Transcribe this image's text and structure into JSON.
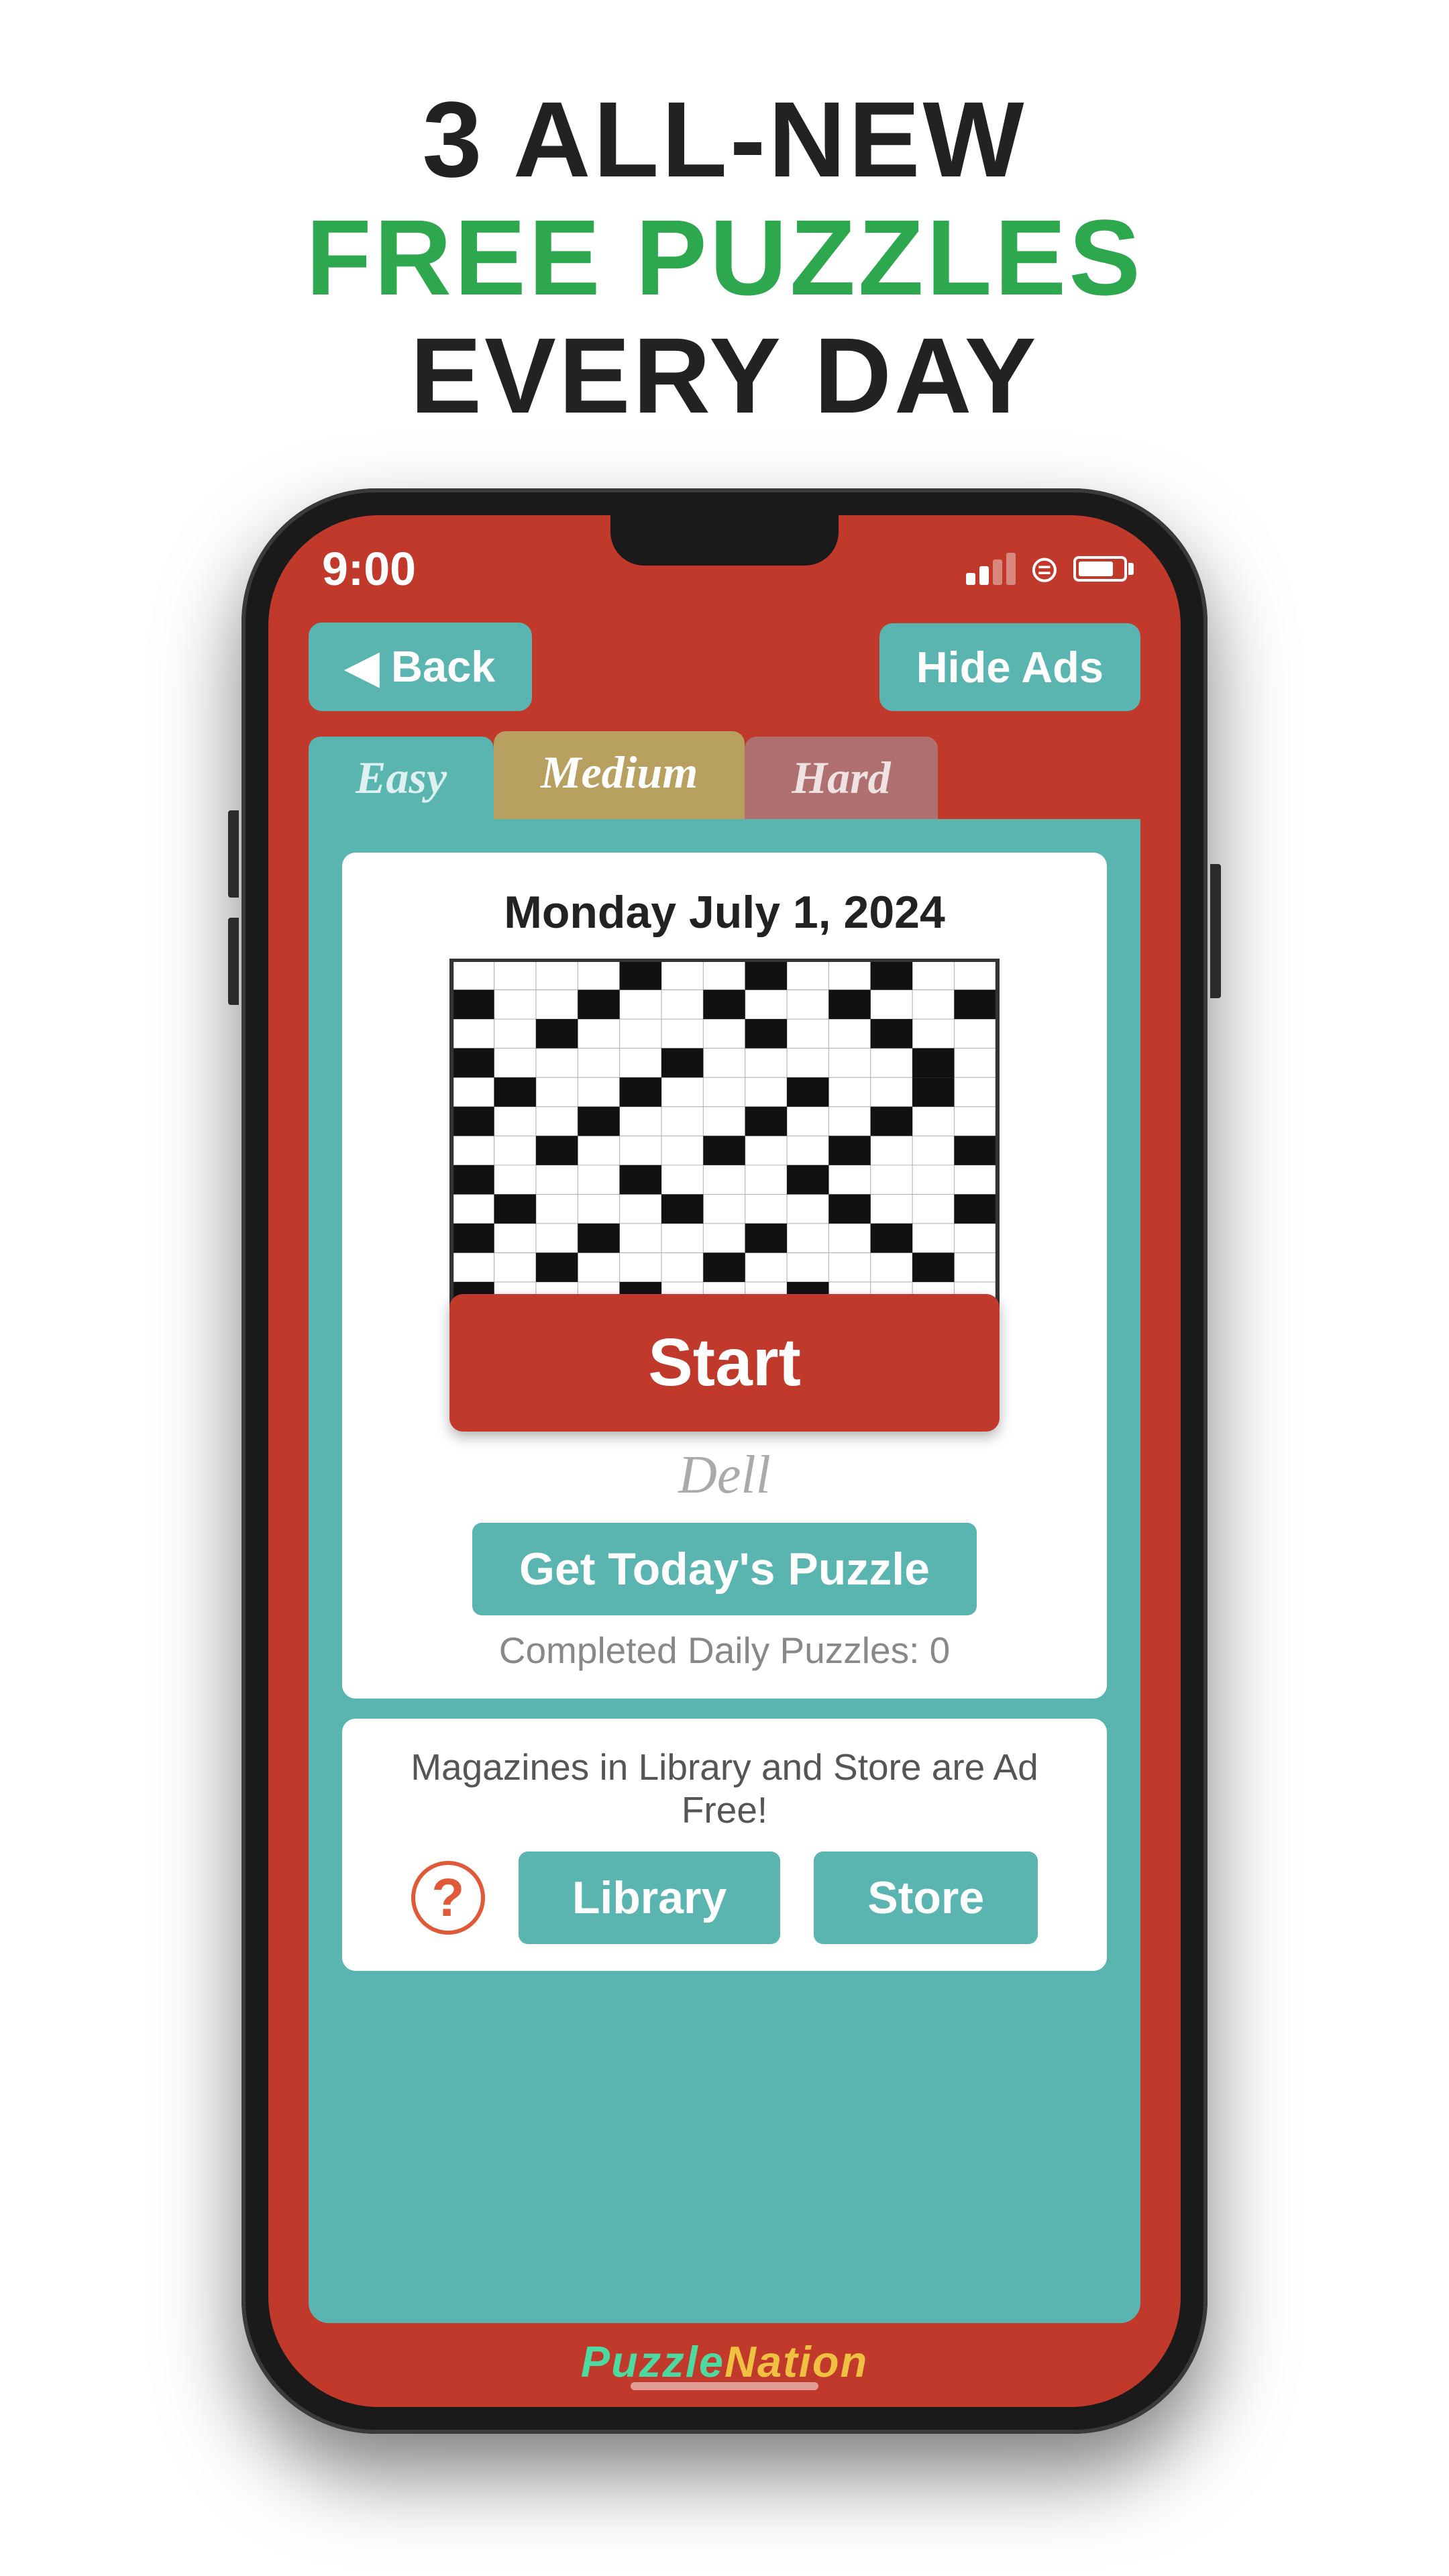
{
  "headline": {
    "line1": "3 ALL-NEW",
    "line2": "FREE PUZZLES",
    "line3": "EVERY DAY"
  },
  "phone": {
    "status": {
      "time": "9:00"
    },
    "back_button": "◀  Back",
    "hide_ads_button": "Hide Ads",
    "tabs": [
      {
        "label": "Easy",
        "id": "easy"
      },
      {
        "label": "Medium",
        "id": "medium"
      },
      {
        "label": "Hard",
        "id": "hard"
      }
    ],
    "puzzle": {
      "date": "Monday July 1, 2024",
      "start_label": "Start",
      "publisher": "Dell",
      "get_puzzle_label": "Get Today's Puzzle",
      "completed_text": "Completed Daily Puzzles: 0"
    },
    "bottom": {
      "ad_free_text": "Magazines in Library and Store are Ad Free!",
      "library_label": "Library",
      "store_label": "Store",
      "help_icon": "?"
    },
    "footer": {
      "logo_text": "PuzzleNation"
    }
  },
  "colors": {
    "red": "#c0392b",
    "teal": "#5ab5b0",
    "tan": "#b8a060",
    "green": "#2da84e"
  }
}
